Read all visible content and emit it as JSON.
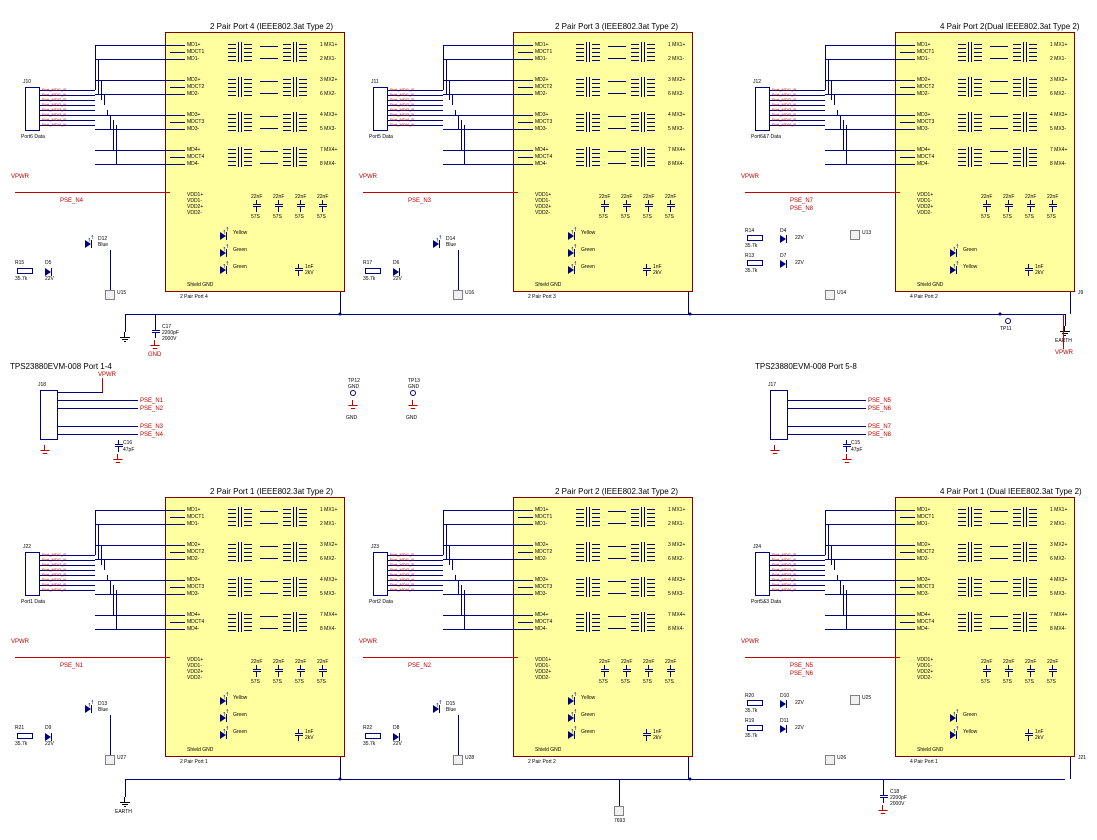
{
  "blocks": {
    "top_left": {
      "title": "2 Pair Port 4 (IEEE802.3at Type 2)",
      "sub": "2 Pair Port 4",
      "conn_ref": "J10",
      "conn_label": "Port6 Data"
    },
    "top_mid": {
      "title": "2 Pair Port 3 (IEEE802.3at Type 2)",
      "sub": "2 Pair Port 3",
      "conn_ref": "J11",
      "conn_label": "Port5 Data"
    },
    "top_right": {
      "title": "4 Pair Port 2(Dual IEEE802.3at Type 2)",
      "sub": "4 Pair Port 2",
      "conn_ref": "J12",
      "conn_label": "Port6&7 Data"
    },
    "bot_left": {
      "title": "2 Pair Port 1 (IEEE802.3at Type 2)",
      "sub": "2 Pair Port 1",
      "conn_ref": "J22",
      "conn_label": "Port1 Data"
    },
    "bot_mid": {
      "title": "2 Pair Port 2 (IEEE802.3at Type 2)",
      "sub": "2 Pair Port 2",
      "conn_ref": "J23",
      "conn_label": "Port2 Data"
    },
    "bot_right": {
      "title": "4 Pair Port 1 (Dual IEEE802.3at Type 2)",
      "sub": "4 Pair Port 1",
      "conn_ref": "J24",
      "conn_label": "Port5&3 Data"
    }
  },
  "mid_connectors": {
    "left": {
      "title": "TPS23880EVM-008 Port 1-4",
      "ref": "J18"
    },
    "right": {
      "title": "TPS23880EVM-008 Port 5-8",
      "ref": "J17"
    }
  },
  "testpoints": {
    "tp11": "TP11",
    "tp12": "TP12\nGND",
    "tp13": "TP13\nGND"
  },
  "power": {
    "vpwr": "VPWR",
    "gnd": "GND",
    "earth": "EARTH"
  },
  "nets": {
    "pse_n1": "PSE_N1",
    "pse_n2": "PSE_N2",
    "pse_n3": "PSE_N3",
    "pse_n4": "PSE_N4",
    "pse_n5": "PSE_N5",
    "pse_n6": "PSE_N6",
    "pse_n7": "PSE_N7",
    "pse_n8": "PSE_N8"
  },
  "components": {
    "cap_main_top": {
      "ref": "C17",
      "val1": "2200pF",
      "val2": "2000V"
    },
    "cap_main_bot": {
      "ref": "C18",
      "val1": "2200pF",
      "val2": "2000V"
    },
    "cap_mid_right": {
      "ref": "C15",
      "val": "47pF"
    },
    "cap_mid_left": {
      "ref": "C16",
      "val": "47pF"
    },
    "cap_block": {
      "val1": "22nF",
      "val2": "1nF\n2kV"
    },
    "res_term": "57S",
    "res_pd": "35.7k",
    "zener": "22V",
    "bead": "7693",
    "leds": {
      "blue": "Blue",
      "yellow": "Yellow",
      "green": "Green"
    },
    "refs_top_left": {
      "r_pd": "R15",
      "d_z": "D5",
      "led_b": "D12",
      "bead": "U15"
    },
    "refs_top_mid": {
      "r_pd": "R17",
      "d_z": "D6",
      "led_b": "D14",
      "bead": "U16"
    },
    "refs_top_right": {
      "r1": "R14",
      "r2": "R13",
      "d1": "D4",
      "d2": "D7",
      "bead1": "U13",
      "bead2": "U14"
    },
    "refs_bot_left": {
      "r_pd": "R21",
      "d_z": "D9",
      "led_b": "D13",
      "bead": "U27"
    },
    "refs_bot_mid": {
      "r_pd": "R22",
      "d_z": "D8",
      "led_b": "D15",
      "bead": "U28"
    },
    "refs_bot_right": {
      "r1": "R20",
      "r2": "R19",
      "d1": "D10",
      "d2": "D11",
      "bead1": "U25",
      "bead2": "U26"
    }
  },
  "pins": {
    "mx": [
      "1 MX1+",
      "2 MX1-",
      "3 MX2+",
      "6 MX2-",
      "4 MX3+",
      "5 MX3-",
      "7 MX4+",
      "8 MX4-"
    ],
    "md": [
      "MD1+",
      "MD1-",
      "MDCT1",
      "MD2+",
      "MD2-",
      "MDCT2",
      "MD3+",
      "MD3-",
      "MDCT3",
      "MD4+",
      "MD4-",
      "MDCT4"
    ],
    "vdd": [
      "VDD1+",
      "VDD1-",
      "VDD2+",
      "VDD2-"
    ],
    "shield": "Shield GND"
  },
  "data_bus": {
    "labels": [
      "Port_MDI1_P",
      "Port_MDI1_N",
      "Port_MDI2_P",
      "Port_MDI2_N",
      "Port_MDI3_P",
      "Port_MDI3_N",
      "Port_MDI4_P",
      "Port_MDI4_N"
    ]
  },
  "rj45_refs": {
    "top_right": "J9",
    "bot_right": "J21"
  }
}
